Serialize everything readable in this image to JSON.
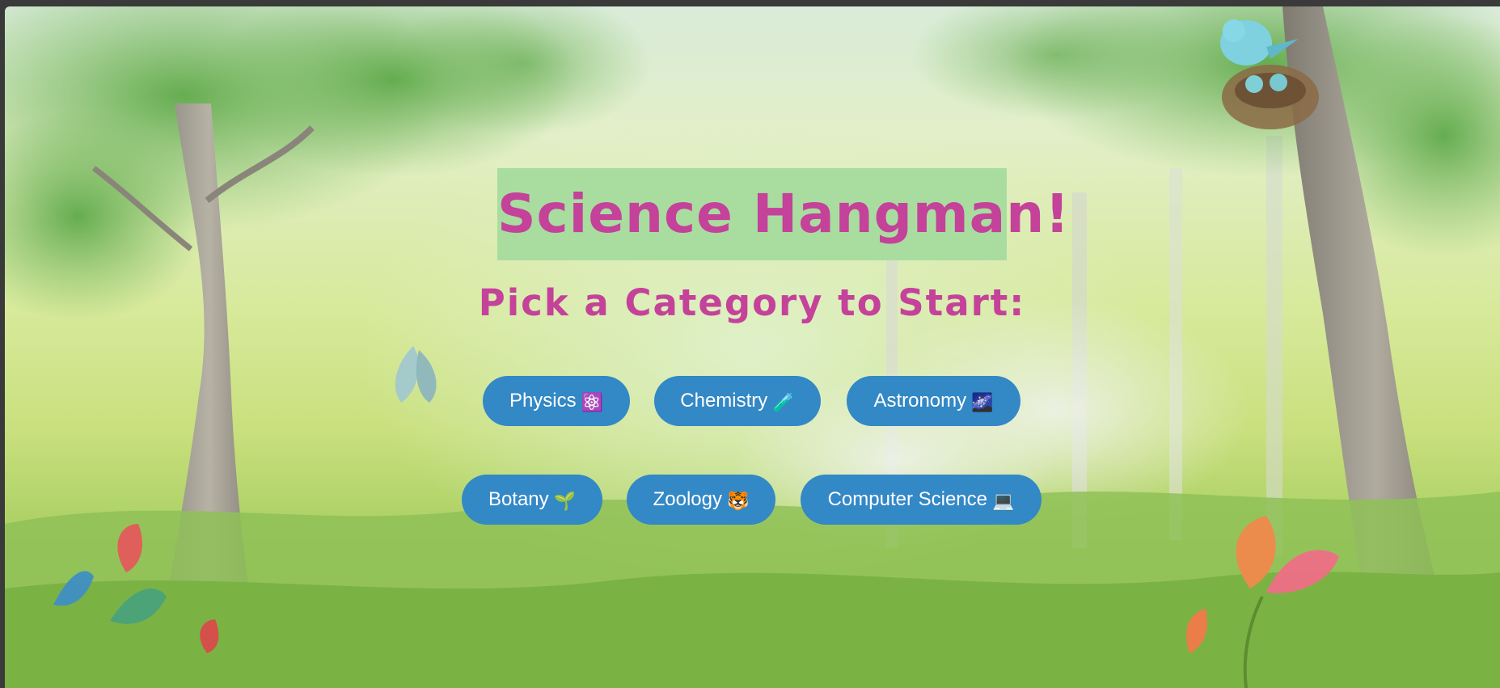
{
  "game": {
    "title": "Science Hangman!",
    "subtitle": "Pick a Category to Start:",
    "categories": [
      {
        "label": "Physics",
        "emoji": "⚛️"
      },
      {
        "label": "Chemistry",
        "emoji": "🧪"
      },
      {
        "label": "Astronomy",
        "emoji": "🌌"
      },
      {
        "label": "Botany",
        "emoji": "🌱"
      },
      {
        "label": "Zoology",
        "emoji": "🐯"
      },
      {
        "label": "Computer Science",
        "emoji": "💻"
      }
    ]
  },
  "colors": {
    "title_text": "#c4429a",
    "title_background": "#a9dda0",
    "button_background": "#3388c6",
    "button_text": "#ffffff"
  }
}
